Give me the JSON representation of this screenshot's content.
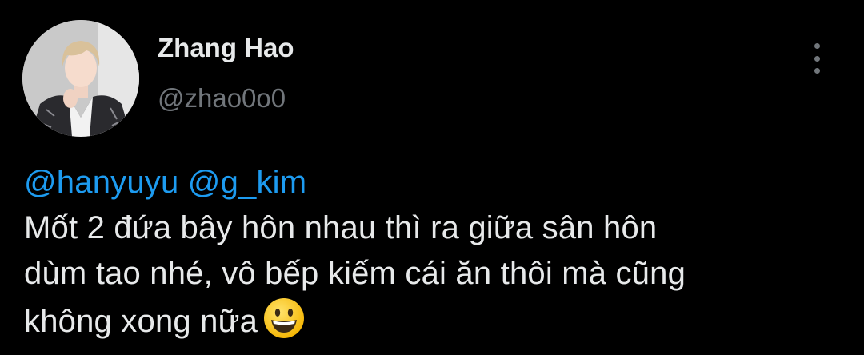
{
  "author": {
    "display_name": "Zhang Hao",
    "handle": "@zhao0o0"
  },
  "tweet": {
    "mentions": [
      "@hanyuyu",
      "@g_kim"
    ],
    "lines": [
      "Mốt 2 đứa bây hôn nhau thì ra giữa sân hôn",
      "dùm tao nhé, vô bếp kiếm cái ăn thôi mà cũng",
      "không xong nữa"
    ],
    "emoji": "grinning-face"
  },
  "icons": {
    "more": "more-vertical-icon"
  },
  "colors": {
    "background": "#000000",
    "text_primary": "#e7e9ea",
    "text_secondary": "#71767b",
    "mention": "#1d9bf0"
  }
}
